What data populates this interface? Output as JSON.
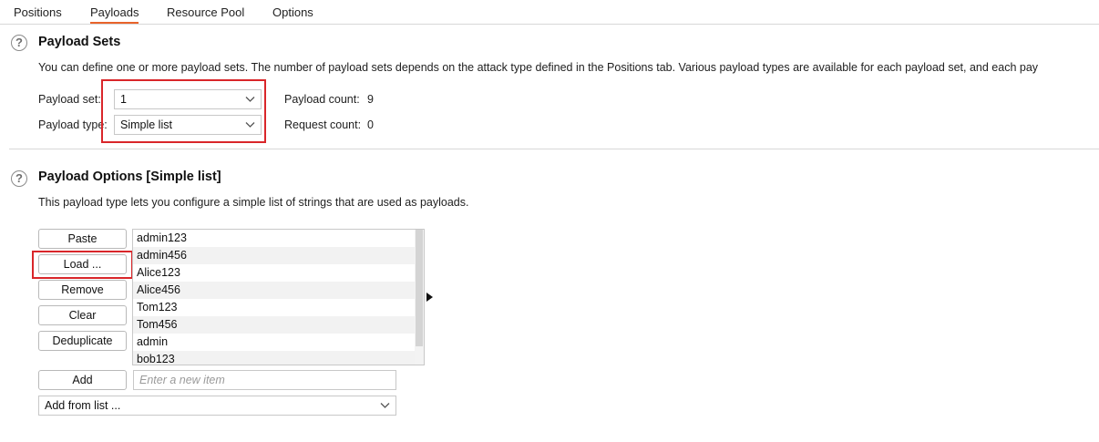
{
  "tabs": [
    {
      "label": "Positions"
    },
    {
      "label": "Payloads"
    },
    {
      "label": "Resource Pool"
    },
    {
      "label": "Options"
    }
  ],
  "active_tab": "Payloads",
  "accent_color": "#e8632b",
  "highlight_color": "#d9262a",
  "payload_sets": {
    "icon": "help-circle-icon",
    "title": "Payload Sets",
    "description": "You can define one or more payload sets. The number of payload sets depends on the attack type defined in the Positions tab. Various payload types are available for each payload set, and each pay",
    "payload_set_label": "Payload set:",
    "payload_set_value": "1",
    "payload_type_label": "Payload type:",
    "payload_type_value": "Simple list",
    "payload_count_label": "Payload count:",
    "payload_count_value": "9",
    "request_count_label": "Request count:",
    "request_count_value": "0"
  },
  "payload_options": {
    "icon": "help-circle-icon",
    "title": "Payload Options [Simple list]",
    "description": "This payload type lets you configure a simple list of strings that are used as payloads.",
    "buttons": {
      "paste": "Paste",
      "load": "Load ...",
      "remove": "Remove",
      "clear": "Clear",
      "deduplicate": "Deduplicate",
      "add": "Add"
    },
    "items": [
      "admin123",
      "admin456",
      "Alice123",
      "Alice456",
      "Tom123",
      "Tom456",
      "admin",
      "bob123"
    ],
    "new_item_placeholder": "Enter a new item",
    "add_from_list_value": "Add from list ..."
  }
}
